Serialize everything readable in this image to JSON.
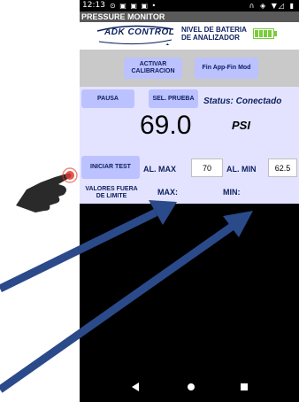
{
  "status_bar": {
    "time": "12:13",
    "left_icons": "⊙ ▣ ▣ ▣ •",
    "right_icons": "∩ ◈ ▼◿ ▮"
  },
  "app": {
    "title": "PRESSURE MONITOR"
  },
  "header": {
    "logo_text": "ADK CONTROL",
    "battery_label_line1": "NIVEL DE BATERIA",
    "battery_label_line2": "DE ANALIZADOR",
    "battery_color": "#7acc3b"
  },
  "toolbar": {
    "activate_line1": "ACTIVAR",
    "activate_line2": "CALIBRACION",
    "end_mode_label": "Fin App-Fin Mod"
  },
  "controls": {
    "pause_label": "PAUSA",
    "select_test_label": "SEL. PRUEBA",
    "status_text": "Status: Conectado"
  },
  "reading": {
    "value": "69.0",
    "unit": "PSI"
  },
  "limits": {
    "start_test_label": "INICIAR TEST",
    "max_label": "AL. MAX",
    "max_value": "70",
    "min_label": "AL. MIN",
    "min_value": "62.5"
  },
  "out_of_limits": {
    "label_line1": "VALORES FUERA",
    "label_line2": "DE LIMITE",
    "max_label": "MAX:",
    "min_label": "MIN:"
  },
  "colors": {
    "accent_button": "#bcc1ff",
    "panel_bg": "#e3e3ff",
    "annotation_arrow": "#2b4a8a"
  }
}
